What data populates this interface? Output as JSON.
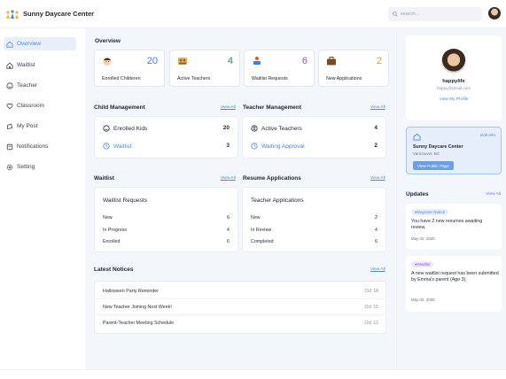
{
  "app": {
    "name": "Sunny Daycare Center"
  },
  "search": {
    "placeholder": "search..."
  },
  "sidebar": {
    "items": [
      {
        "label": "Overview",
        "icon": "home-icon",
        "active": true
      },
      {
        "label": "Waitlist",
        "icon": "home-outline-icon"
      },
      {
        "label": "Teacher",
        "icon": "smile-icon"
      },
      {
        "label": "Classroom",
        "icon": "heart-icon"
      },
      {
        "label": "My Post",
        "icon": "post-icon"
      },
      {
        "label": "Notifications",
        "icon": "bell-icon"
      },
      {
        "label": "Setting",
        "icon": "gear-icon"
      }
    ]
  },
  "overview": {
    "title": "Overview",
    "stats": [
      {
        "label": "Enrolled Childeren",
        "value": "20",
        "color": "#3f7de0",
        "icon": "child-icon"
      },
      {
        "label": "Active Teachers",
        "value": "4",
        "color": "#2b8a6a",
        "icon": "teacher-icon"
      },
      {
        "label": "Waitlist Requests",
        "value": "6",
        "color": "#8a5cd6",
        "icon": "waitlist-icon"
      },
      {
        "label": "New Applications",
        "value": "2",
        "color": "#e0a020",
        "icon": "briefcase-icon"
      }
    ]
  },
  "child_management": {
    "title": "Child Management",
    "view_all": "View All",
    "rows": [
      {
        "label": "Enrolled Kids",
        "value": "20",
        "icon": "smile-icon"
      },
      {
        "label": "Waitlist",
        "value": "3",
        "icon": "clock-icon"
      }
    ]
  },
  "teacher_management": {
    "title": "Teacher Management",
    "view_all": "View All",
    "rows": [
      {
        "label": "Active Teachers",
        "value": "4",
        "icon": "badge-icon"
      },
      {
        "label": "Waiting Approval",
        "value": "2",
        "icon": "clock-icon"
      }
    ]
  },
  "waitlist": {
    "title": "Waitlist",
    "view_all": "View All",
    "card_title": "Waitlist Requests",
    "rows": [
      {
        "label": "New",
        "value": "6"
      },
      {
        "label": "In Progress",
        "value": "4"
      },
      {
        "label": "Enrolled",
        "value": "6"
      }
    ]
  },
  "resume": {
    "title": "Resume Applications",
    "view_all": "View All",
    "card_title": "Teacher Applications",
    "rows": [
      {
        "label": "New",
        "value": "2"
      },
      {
        "label": "In Review",
        "value": "4"
      },
      {
        "label": "Completed",
        "value": "6"
      }
    ]
  },
  "notices": {
    "title": "Latest Notices",
    "view_all": "View All",
    "rows": [
      {
        "title": "Halloween Party Reminder",
        "date": "Oct 18"
      },
      {
        "title": "New Teacher Joining Next Week!",
        "date": "Oct 15"
      },
      {
        "title": "Parent-Teacher Meeting Schedule",
        "date": "Oct 12"
      }
    ]
  },
  "profile": {
    "name": "happylife",
    "email": "happy@gmail.com",
    "button": "View My Profile"
  },
  "center": {
    "edit": "Edit Info",
    "name": "Sunny Daycare Center",
    "location": "Vancouver, BC",
    "button": "View Public Page"
  },
  "updates": {
    "title": "Updates",
    "view_all": "View All",
    "items": [
      {
        "tag": "Daycare Notice",
        "tag_color": "#4a87e0",
        "text": "You have 2 new resumes awaiting review.",
        "date": "May 02, 2025"
      },
      {
        "tag": "Waitlist",
        "tag_color": "#8a5cd6",
        "text": "A new waitlist request has been submitted by Emma's parent (Age 3).",
        "date": "May 02, 2025"
      }
    ]
  }
}
